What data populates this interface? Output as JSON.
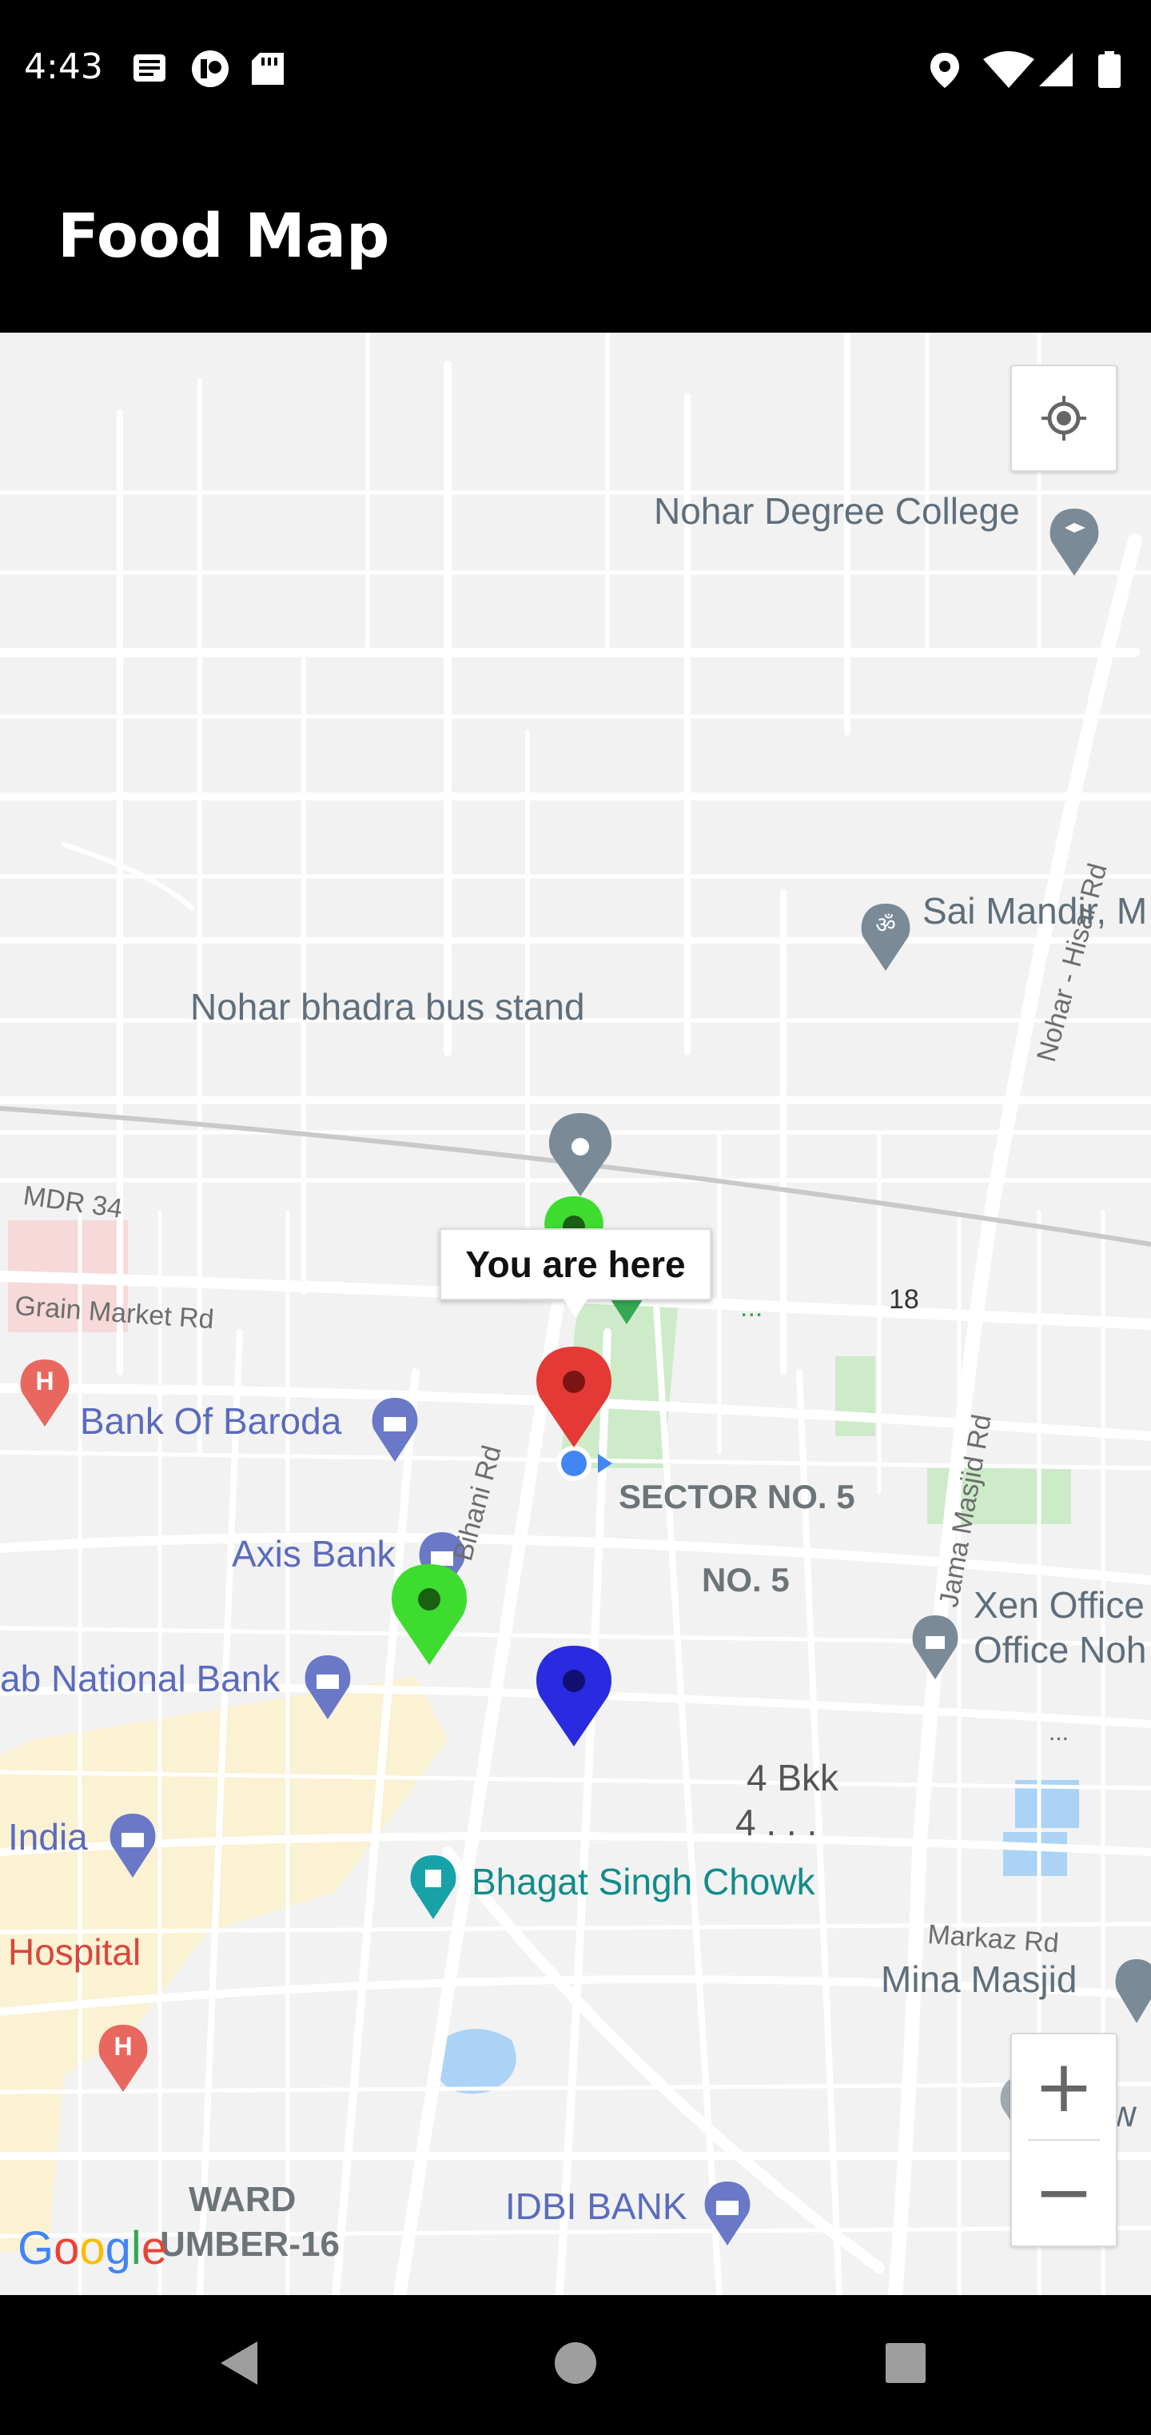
{
  "status_bar": {
    "time": "4:43",
    "left_icons": [
      "news-icon",
      "sim-icon",
      "sd-card-icon"
    ],
    "right_icons": [
      "location-icon",
      "wifi-icon",
      "cellular-signal-icon",
      "battery-icon"
    ]
  },
  "app_bar": {
    "title": "Food Map"
  },
  "map": {
    "labels": {
      "nohar_degree_college": "Nohar Degree College",
      "nohar_hisar_rd": "Nohar - Hisar Rd",
      "sai_mandir": "Sai Mandir, M",
      "bus_stand": "Nohar bhadra bus stand",
      "mdr34": "MDR 34",
      "grain_market_rd": "Grain Market Rd",
      "bank_of_baroda": "Bank Of Baroda",
      "bihani_rd": "Bihani Rd",
      "sector5": "SECTOR NO. 5",
      "no5": "NO. 5",
      "jama_masjid_rd": "Jama Masjid Rd",
      "xen_office_1": "Xen Office",
      "xen_office_2": "Office Noh",
      "axis_bank": "Axis Bank",
      "pnb": "ab National Bank",
      "four_bkk_1": "4 Bkk",
      "four_bkk_2": "4 . . .",
      "india": "India",
      "bhagat_singh_chowk": "Bhagat Singh Chowk",
      "hospital": "Hospital",
      "markaz_rd": "Markaz Rd",
      "mina_masjid": "Mina Masjid",
      "new": "New",
      "ward_1": "WARD",
      "ward_2": "UMBER-16",
      "idbi_bank": "IDBI BANK",
      "road_18": "18",
      "dots_1": "...",
      "dots_2": "..."
    },
    "info_window": "You are here",
    "markers": [
      {
        "name": "marker-red-current",
        "color": "#e53935"
      },
      {
        "name": "marker-green-top",
        "color": "#3ddc2f"
      },
      {
        "name": "marker-green-axis",
        "color": "#3ddc2f"
      },
      {
        "name": "marker-blue",
        "color": "#2a2ae0"
      },
      {
        "name": "marker-grey",
        "color": "#7a8a96"
      }
    ],
    "google_logo": "Google",
    "zoom_in": "+",
    "zoom_out": "−"
  },
  "nav_bar": {
    "buttons": [
      "back-icon",
      "home-icon",
      "recents-icon"
    ]
  }
}
